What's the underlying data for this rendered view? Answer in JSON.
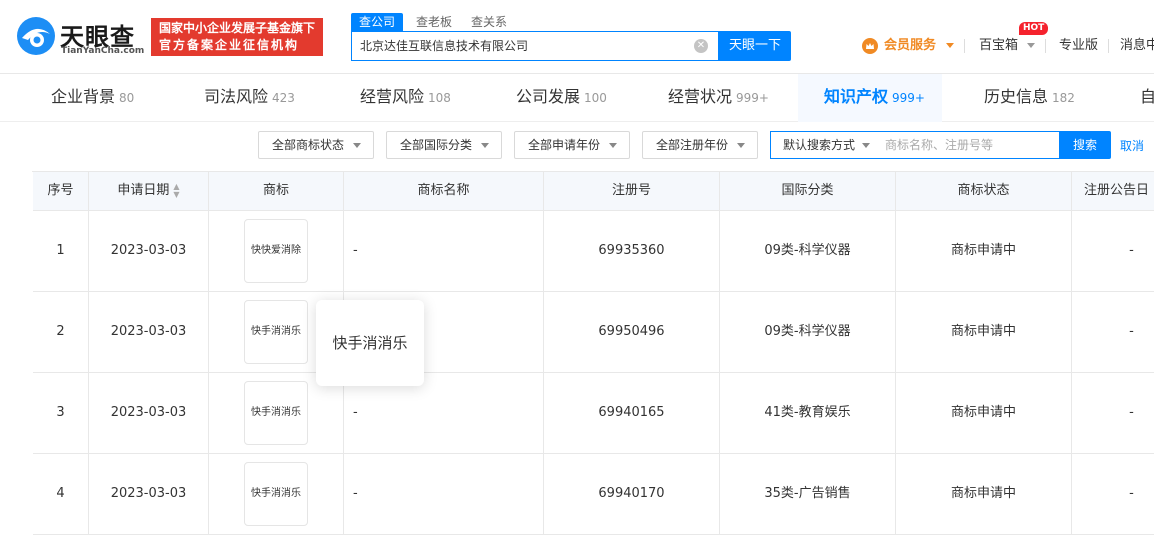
{
  "brand": {
    "name_cn": "天眼查",
    "name_en": "TianYanCha.com",
    "badge_line1": "国家中小企业发展子基金旗下",
    "badge_line2": "官方备案企业征信机构"
  },
  "search": {
    "tabs": [
      "查公司",
      "查老板",
      "查关系"
    ],
    "value": "北京达佳互联信息技术有限公司",
    "button": "天眼一下"
  },
  "top_nav": {
    "vip": "会员服务",
    "baibaoxiang": "百宝箱",
    "hot": "HOT",
    "pro": "专业版",
    "message": "消息中"
  },
  "categories": [
    {
      "label": "企业背景",
      "count": "80"
    },
    {
      "label": "司法风险",
      "count": "423"
    },
    {
      "label": "经营风险",
      "count": "108"
    },
    {
      "label": "公司发展",
      "count": "100"
    },
    {
      "label": "经营状况",
      "count": "999+"
    },
    {
      "label": "知识产权",
      "count": "999+"
    },
    {
      "label": "历史信息",
      "count": "182"
    },
    {
      "label": "自",
      "count": ""
    }
  ],
  "filters": {
    "status": "全部商标状态",
    "intl_class": "全部国际分类",
    "apply_year": "全部申请年份",
    "reg_year": "全部注册年份",
    "search_mode": "默认搜索方式",
    "search_placeholder": "商标名称、注册号等",
    "search_button": "搜索",
    "cancel": "取消"
  },
  "table": {
    "headers": [
      "序号",
      "申请日期",
      "商标",
      "商标名称",
      "注册号",
      "国际分类",
      "商标状态",
      "注册公告日"
    ],
    "rows": [
      {
        "no": "1",
        "date": "2023-03-03",
        "image_text": "快快爱消除",
        "name": "-",
        "reg_no": "69935360",
        "class": "09类-科学仪器",
        "status": "商标申请中",
        "pub_date": "-"
      },
      {
        "no": "2",
        "date": "2023-03-03",
        "image_text": "快手消消乐",
        "name": "-",
        "reg_no": "69950496",
        "class": "09类-科学仪器",
        "status": "商标申请中",
        "pub_date": "-"
      },
      {
        "no": "3",
        "date": "2023-03-03",
        "image_text": "快手消消乐",
        "name": "-",
        "reg_no": "69940165",
        "class": "41类-教育娱乐",
        "status": "商标申请中",
        "pub_date": "-"
      },
      {
        "no": "4",
        "date": "2023-03-03",
        "image_text": "快手消消乐",
        "name": "-",
        "reg_no": "69940170",
        "class": "35类-广告销售",
        "status": "商标申请中",
        "pub_date": "-"
      }
    ]
  },
  "tooltip": {
    "text": "快手消消乐"
  },
  "colors": {
    "primary": "#0084ff",
    "badge_red": "#e33a2e",
    "vip_orange": "#f08a24"
  }
}
